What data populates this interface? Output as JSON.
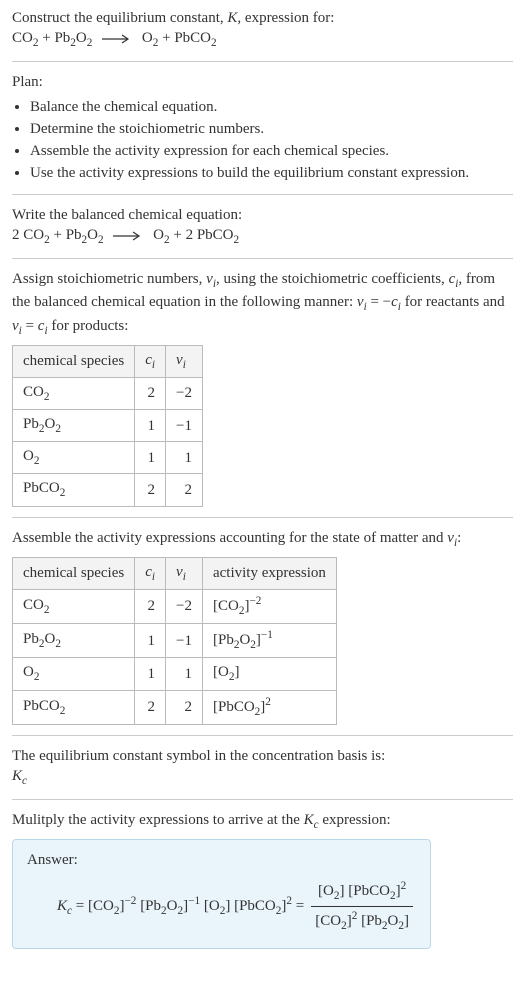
{
  "intro": {
    "line1_a": "Construct the equilibrium constant, ",
    "line1_k": "K",
    "line1_b": ", expression for:"
  },
  "eq1": {
    "r1": "CO",
    "r1s": "2",
    "r2a": "Pb",
    "r2as": "2",
    "r2b": "O",
    "r2bs": "2",
    "p1": "O",
    "p1s": "2",
    "p2": "PbCO",
    "p2s": "2",
    "plus": " + "
  },
  "plan": {
    "title": "Plan:",
    "items": [
      "Balance the chemical equation.",
      "Determine the stoichiometric numbers.",
      "Assemble the activity expression for each chemical species.",
      "Use the activity expressions to build the equilibrium constant expression."
    ]
  },
  "balanced": {
    "title": "Write the balanced chemical equation:",
    "c1": "2 ",
    "c2": "2 "
  },
  "stoich": {
    "intro_a": "Assign stoichiometric numbers, ",
    "nu": "ν",
    "i": "i",
    "intro_b": ", using the stoichiometric coefficients, ",
    "c": "c",
    "intro_c": ", from the balanced chemical equation in the following manner: ",
    "rule1a": "ν",
    "rule1b": " = −",
    "rule1c": "c",
    "rule1d": " for reactants and ",
    "rule2a": "ν",
    "rule2b": " = ",
    "rule2c": "c",
    "rule2d": " for products:",
    "headers": {
      "sp": "chemical species",
      "c": "c",
      "nu": "ν",
      "i": "i"
    },
    "rows": [
      {
        "sp": "CO",
        "sps": "2",
        "c": "2",
        "nu": "−2"
      },
      {
        "sp": "Pb2O2",
        "c": "1",
        "nu": "−1"
      },
      {
        "sp": "O",
        "sps": "2",
        "c": "1",
        "nu": "1"
      },
      {
        "sp": "PbCO",
        "sps": "2",
        "c": "2",
        "nu": "2"
      }
    ]
  },
  "activity": {
    "intro_a": "Assemble the activity expressions accounting for the state of matter and ",
    "intro_b": ":",
    "headers": {
      "sp": "chemical species",
      "c": "c",
      "nu": "ν",
      "i": "i",
      "act": "activity expression"
    },
    "rows": [
      {
        "sp": "CO",
        "sps": "2",
        "c": "2",
        "nu": "−2",
        "base": "CO",
        "bases": "2",
        "exp": "−2"
      },
      {
        "sp": "Pb2O2",
        "c": "1",
        "nu": "−1",
        "base": "Pb2O2",
        "exp": "−1"
      },
      {
        "sp": "O",
        "sps": "2",
        "c": "1",
        "nu": "1",
        "base": "O",
        "bases": "2",
        "exp": ""
      },
      {
        "sp": "PbCO",
        "sps": "2",
        "c": "2",
        "nu": "2",
        "base": "PbCO",
        "bases": "2",
        "exp": "2"
      }
    ]
  },
  "symbol": {
    "line": "The equilibrium constant symbol in the concentration basis is:",
    "K": "K",
    "c": "c"
  },
  "multiply": {
    "intro_a": "Mulitply the activity expressions to arrive at the ",
    "intro_b": " expression:"
  },
  "answer": {
    "label": "Answer:",
    "K": "K",
    "c": "c",
    "eq": " = ",
    "t1": "CO",
    "t1s": "2",
    "t1e": "−2",
    "t2": "Pb2O2",
    "t2e": "−1",
    "t3": "O",
    "t3s": "2",
    "t4": "PbCO",
    "t4s": "2",
    "t4e": "2",
    "eq2": " = ",
    "num_a": "O",
    "num_as": "2",
    "num_b": "PbCO",
    "num_bs": "2",
    "num_be": "2",
    "den_a": "CO",
    "den_as": "2",
    "den_ae": "2",
    "den_b": "Pb2O2"
  },
  "chart_data": {
    "type": "table",
    "tables": [
      {
        "title": "Stoichiometric numbers",
        "columns": [
          "chemical species",
          "c_i",
          "nu_i"
        ],
        "rows": [
          [
            "CO2",
            2,
            -2
          ],
          [
            "Pb2O2",
            1,
            -1
          ],
          [
            "O2",
            1,
            1
          ],
          [
            "PbCO2",
            2,
            2
          ]
        ]
      },
      {
        "title": "Activity expressions",
        "columns": [
          "chemical species",
          "c_i",
          "nu_i",
          "activity expression"
        ],
        "rows": [
          [
            "CO2",
            2,
            -2,
            "[CO2]^-2"
          ],
          [
            "Pb2O2",
            1,
            -1,
            "[Pb2O2]^-1"
          ],
          [
            "O2",
            1,
            1,
            "[O2]"
          ],
          [
            "PbCO2",
            2,
            2,
            "[PbCO2]^2"
          ]
        ]
      }
    ]
  }
}
